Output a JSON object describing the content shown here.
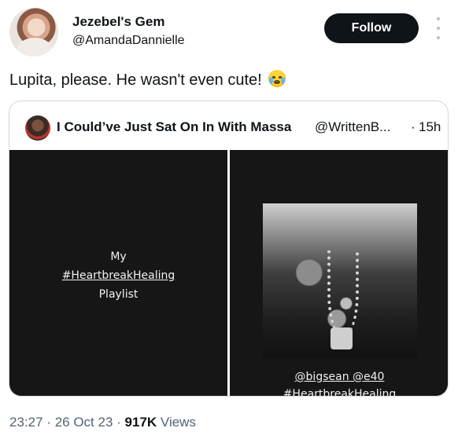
{
  "author": {
    "display_name": "Jezebel's Gem",
    "handle": "@AmandaDannielle"
  },
  "follow_label": "Follow",
  "tweet": {
    "text": "Lupita, please. He wasn't even cute!",
    "emoji": "loudly-crying-face"
  },
  "quote": {
    "display_name": "I Could’ve Just Sat On In With Massa",
    "handle": "@WrittenB...",
    "separator": "·",
    "time": "15h",
    "media_left": {
      "line1": "My",
      "line2": "#HeartbreakHealing",
      "line3": "Playlist"
    },
    "media_right": {
      "artists": "@bigsean @e40",
      "hashtag": "#HeartbreakHealing"
    }
  },
  "meta": {
    "time": "23:27",
    "sep1": "·",
    "date": "26 Oct 23",
    "sep2": "·",
    "views_count": "917K",
    "views_label": "Views"
  },
  "colors": {
    "text": "#0f1419",
    "secondary": "#536471",
    "border": "#cfd9de",
    "follow_bg": "#0f1419"
  }
}
